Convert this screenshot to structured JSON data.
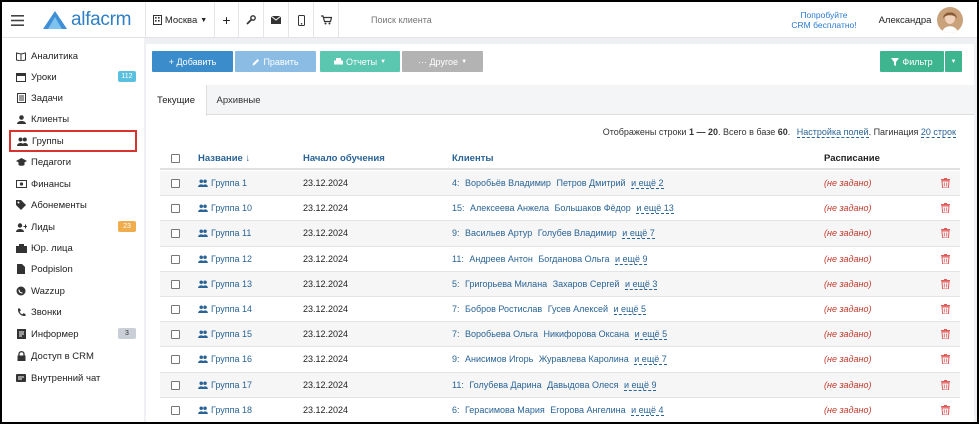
{
  "brand": {
    "logo_text": "alfacrm"
  },
  "topbar": {
    "city": "Москва",
    "search_placeholder": "Поиск клиента",
    "promo_line1": "Попробуйте",
    "promo_line2": "CRM бесплатно!",
    "user_name": "Александра"
  },
  "sidebar": {
    "items": [
      {
        "label": "Аналитика",
        "icon": "book-icon"
      },
      {
        "label": "Уроки",
        "icon": "calendar-icon",
        "badge": "112",
        "badge_color": "#5bc0de"
      },
      {
        "label": "Задачи",
        "icon": "tasks-icon"
      },
      {
        "label": "Клиенты",
        "icon": "user-icon"
      },
      {
        "label": "Группы",
        "icon": "users-icon",
        "active": true
      },
      {
        "label": "Педагоги",
        "icon": "graduation-cap-icon"
      },
      {
        "label": "Финансы",
        "icon": "money-icon"
      },
      {
        "label": "Абонементы",
        "icon": "tag-icon"
      },
      {
        "label": "Лиды",
        "icon": "user-plus-icon",
        "badge": "23",
        "badge_color": "#f0ad4e"
      },
      {
        "label": "Юр. лица",
        "icon": "building-icon"
      },
      {
        "label": "Podpislon",
        "icon": "file-icon"
      },
      {
        "label": "Wazzup",
        "icon": "whatsapp-icon"
      },
      {
        "label": "Звонки",
        "icon": "phone-icon"
      },
      {
        "label": "Информер",
        "icon": "informer-icon",
        "badge": "3",
        "badge_color": "#c8cfd6"
      },
      {
        "label": "Доступ в CRM",
        "icon": "lock-icon"
      },
      {
        "label": "Внутренний чат",
        "icon": "chat-icon"
      }
    ]
  },
  "toolbar": {
    "add": "+ Добавить",
    "edit": "Править",
    "reports": "Отчеты",
    "other": "··· Другое",
    "filter": "Фильтр"
  },
  "tabs": {
    "current": "Текущие",
    "archive": "Архивные"
  },
  "info": {
    "text": "Отображены строки ",
    "range": "1 — 20",
    "total_prefix": ". Всего в базе ",
    "total": "60",
    "total_suffix": ".",
    "settings_link": "Настройка полей",
    "pagination_label": ". Пагинация ",
    "pagination_value": "20 строк"
  },
  "table": {
    "columns": {
      "name": "Название ↓",
      "start": "Начало обучения",
      "clients": "Клиенты",
      "schedule": "Расписание"
    },
    "rows": [
      {
        "name": "Группа 1",
        "date": "23.12.2024",
        "count": "4:",
        "c1": "Воробьёв Владимир",
        "c2": "Петров Дмитрий",
        "more": "и ещё 2",
        "schedule": "(не задано)"
      },
      {
        "name": "Группа 10",
        "date": "23.12.2024",
        "count": "15:",
        "c1": "Алексеева Анжела",
        "c2": "Большаков Фёдор",
        "more": "и ещё 13",
        "schedule": "(не задано)"
      },
      {
        "name": "Группа 11",
        "date": "23.12.2024",
        "count": "9:",
        "c1": "Васильев Артур",
        "c2": "Голубев Владимир",
        "more": "и ещё 7",
        "schedule": "(не задано)"
      },
      {
        "name": "Группа 12",
        "date": "23.12.2024",
        "count": "11:",
        "c1": "Андреев Антон",
        "c2": "Богданова Ольга",
        "more": "и ещё 9",
        "schedule": "(не задано)"
      },
      {
        "name": "Группа 13",
        "date": "23.12.2024",
        "count": "5:",
        "c1": "Григорьева Милана",
        "c2": "Захаров Сергей",
        "more": "и ещё 3",
        "schedule": "(не задано)"
      },
      {
        "name": "Группа 14",
        "date": "23.12.2024",
        "count": "7:",
        "c1": "Бобров Ростислав",
        "c2": "Гусев Алексей",
        "more": "и ещё 5",
        "schedule": "(не задано)"
      },
      {
        "name": "Группа 15",
        "date": "23.12.2024",
        "count": "7:",
        "c1": "Воробьева Ольга",
        "c2": "Никифорова Оксана",
        "more": "и ещё 5",
        "schedule": "(не задано)"
      },
      {
        "name": "Группа 16",
        "date": "23.12.2024",
        "count": "9:",
        "c1": "Анисимов Игорь",
        "c2": "Журавлева Каролина",
        "more": "и ещё 7",
        "schedule": "(не задано)"
      },
      {
        "name": "Группа 17",
        "date": "23.12.2024",
        "count": "11:",
        "c1": "Голубева Дарина",
        "c2": "Давыдова Олеся",
        "more": "и ещё 9",
        "schedule": "(не задано)"
      },
      {
        "name": "Группа 18",
        "date": "23.12.2024",
        "count": "6:",
        "c1": "Герасимова Мария",
        "c2": "Егорова Ангелина",
        "more": "и ещё 4",
        "schedule": "(не задано)"
      }
    ]
  },
  "colors": {
    "primary": "#3a8ccb",
    "light_blue": "#8bbde4",
    "teal": "#5cc7b0",
    "gray": "#b3b3b3",
    "filter": "#3fb58f",
    "link": "#2a6496",
    "not_set": "#c0392b",
    "highlight": "#d9332f"
  }
}
